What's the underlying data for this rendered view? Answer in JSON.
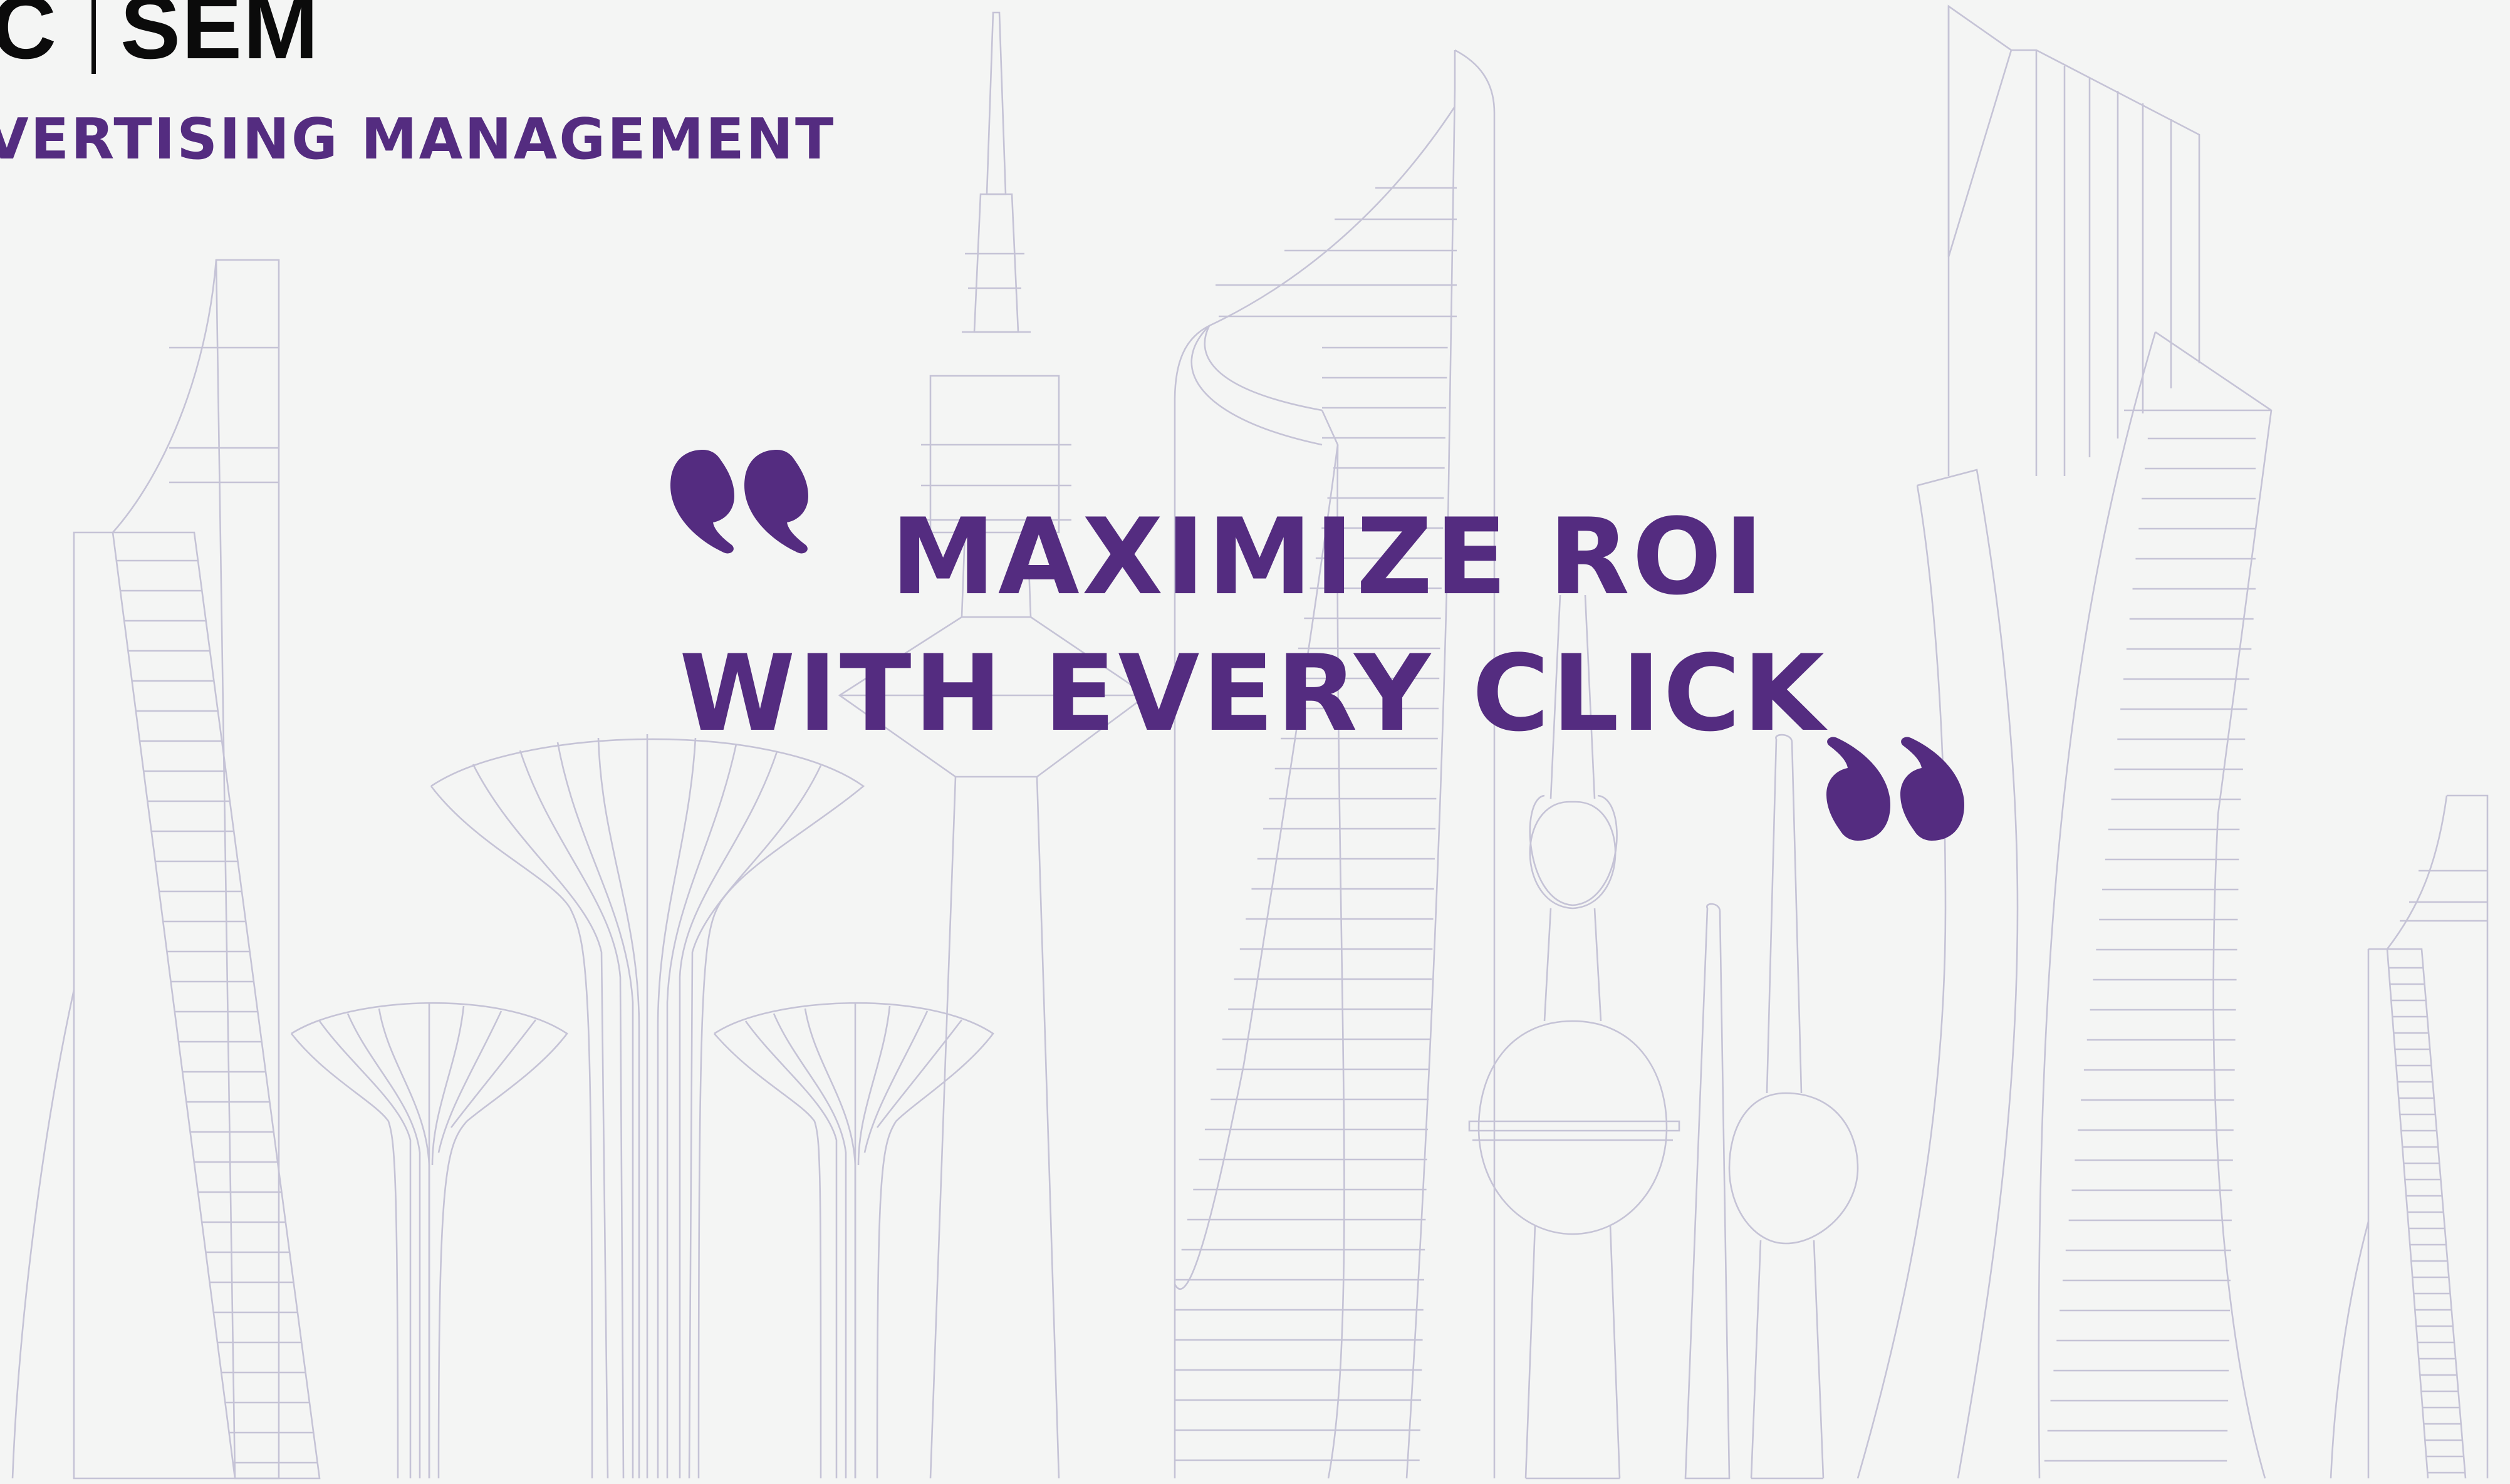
{
  "brand": {
    "left_text": "C",
    "right_text": "SEM",
    "subtitle": "VERTISING MANAGEMENT"
  },
  "headline": {
    "line1": "MAXIMIZE ROI",
    "line2": "WITH EVERY CLICK"
  },
  "colors": {
    "background": "#f4f5f4",
    "accent_purple": "#542c80",
    "brand_black": "#0b0b0b",
    "outline_lavender": "#c5c3d6"
  },
  "icons": {
    "open_quote": "open-quote-icon",
    "close_quote": "close-quote-icon",
    "skyline": "city-skyline-illustration"
  }
}
